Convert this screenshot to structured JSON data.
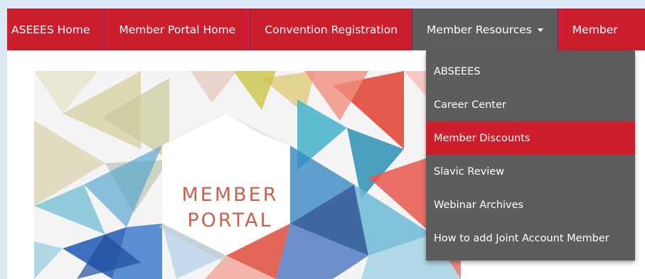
{
  "nav": {
    "items": [
      {
        "label": "ASEEES Home"
      },
      {
        "label": "Member Portal Home"
      },
      {
        "label": "Convention Registration"
      },
      {
        "label": "Member Resources"
      },
      {
        "label": "Member"
      }
    ]
  },
  "dropdown": {
    "items": [
      {
        "label": "ABSEEES"
      },
      {
        "label": "Career Center"
      },
      {
        "label": "Member Discounts"
      },
      {
        "label": "Slavic Review"
      },
      {
        "label": "Webinar Archives"
      },
      {
        "label": "How to add Joint Account Member"
      }
    ],
    "highlighted_index": 2
  },
  "hero": {
    "line1": "MEMBER",
    "line2": "PORTAL"
  },
  "colors": {
    "nav_red": "#cc1e2c",
    "dropdown_gray": "#5d5d5d",
    "hero_text": "#c8614e",
    "page_bg": "#dbe8f5"
  }
}
